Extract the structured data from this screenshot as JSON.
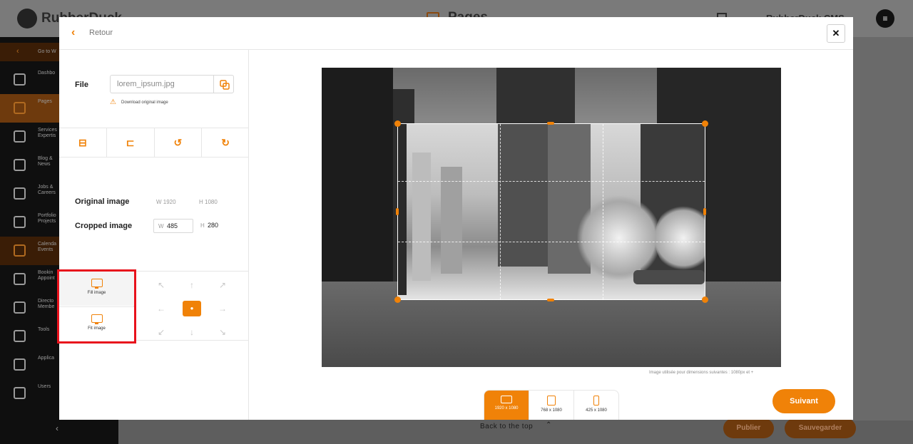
{
  "app": {
    "logo_text": "RubberDuck",
    "page_title": "Pages",
    "brand": "RubberDuck CMS",
    "menu_glyph": "≡"
  },
  "sidebar": {
    "goto_label": "Go to W",
    "items": [
      {
        "label": "Dashbo",
        "icon": "dashboard-icon"
      },
      {
        "label": "Pages",
        "icon": "pages-icon"
      },
      {
        "label": "Services Expertis",
        "icon": "services-icon"
      },
      {
        "label": "Blog & News",
        "icon": "blog-icon"
      },
      {
        "label": "Jobs & Careers",
        "icon": "jobs-icon"
      },
      {
        "label": "Portfolio Projects",
        "icon": "portfolio-icon"
      },
      {
        "label": "Calenda Events",
        "icon": "calendar-icon"
      },
      {
        "label": "Bookin Appoint",
        "icon": "booking-icon"
      },
      {
        "label": "Directo Membe",
        "icon": "directory-icon"
      },
      {
        "label": "Tools",
        "icon": "tools-icon"
      },
      {
        "label": "Applica",
        "icon": "applications-icon"
      },
      {
        "label": "Users",
        "icon": "users-icon"
      }
    ],
    "collapse_glyph": "‹"
  },
  "footer": {
    "back_to_top": "Back to the top",
    "back_to_top_glyph": "⌃",
    "publish": "Publier",
    "save": "Sauvegarder"
  },
  "modal": {
    "back_label": "Retour",
    "back_glyph": "‹",
    "close_glyph": "✕",
    "file": {
      "label": "File",
      "placeholder": "lorem_ipsum.jpg",
      "download_link": "Download original image"
    },
    "tools": [
      {
        "icon": "crop-horizontal-icon",
        "glyph": "⊟"
      },
      {
        "icon": "crop-vertical-icon",
        "glyph": "⊏"
      },
      {
        "icon": "rotate-left-icon",
        "glyph": "↺"
      },
      {
        "icon": "rotate-right-icon",
        "glyph": "↻"
      }
    ],
    "original": {
      "label": "Original image",
      "w": "W  1920",
      "h": "H  1080"
    },
    "cropped": {
      "label": "Cropped image",
      "w_prefix": "W",
      "w_value": "485",
      "h_prefix": "H",
      "h_value": "280"
    },
    "fit": {
      "fill_label": "Fill image",
      "fit_label": "Fit image"
    },
    "position_arrows": [
      "↖",
      "↑",
      "↗",
      "←",
      "●",
      "→",
      "↙",
      "↓",
      "↘"
    ],
    "caption": "Image utilisée pour dimensions suivantes :  1080px et +",
    "devices": [
      {
        "label": "1920 x 1080",
        "icon": "desktop-icon",
        "active": true
      },
      {
        "label": "768 x 1080",
        "icon": "tablet-icon",
        "active": false
      },
      {
        "label": "425 x 1080",
        "icon": "mobile-icon",
        "active": false
      }
    ],
    "next": "Suivant"
  },
  "colors": {
    "accent": "#f08208",
    "highlight": "#e8121c"
  }
}
